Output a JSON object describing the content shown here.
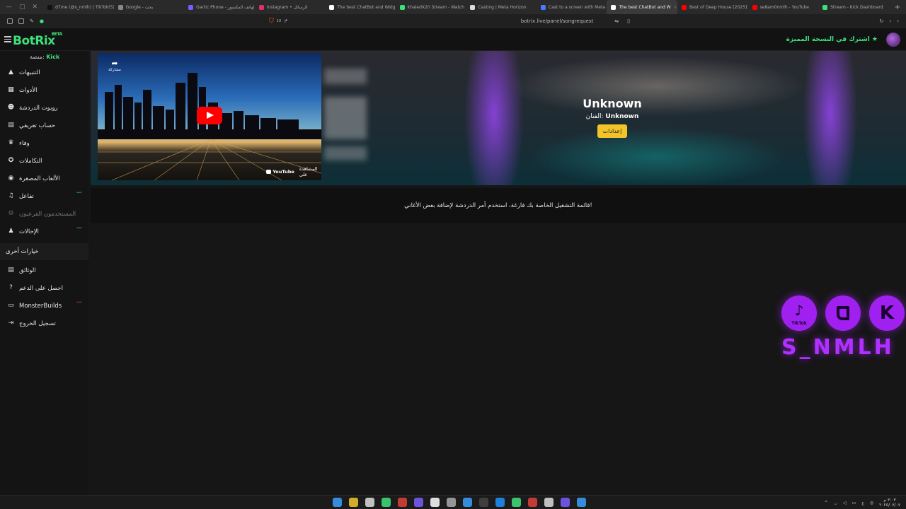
{
  "browser": {
    "tabs": [
      {
        "title": "d7me (@s_nmlh) | TikTok(5)",
        "color": "#111111"
      },
      {
        "title": "Google - بحث",
        "color": "#888888"
      },
      {
        "title": "Gartic Phone - الهاتف المكسور",
        "color": "#7a5cff"
      },
      {
        "title": "Instagram • الرسائل",
        "color": "#e1306c"
      },
      {
        "title": "The best ChatBot and Widg",
        "color": "#ffffff"
      },
      {
        "title": "khaledX20 Stream - Watch",
        "color": "#3ee07a"
      },
      {
        "title": "Casting | Meta Horizon",
        "color": "#dddddd"
      },
      {
        "title": "Cast to a screen with Meta",
        "color": "#4a7bff"
      },
      {
        "title": "The best ChatBot and W",
        "color": "#ffffff",
        "active": true
      },
      {
        "title": "Best of Deep House [2025]",
        "color": "#ff0000"
      },
      {
        "title": "se8am0nmlh - YouTube",
        "color": "#ff0000"
      },
      {
        "title": "Stream - Kick Dashboard",
        "color": "#3ee07a"
      }
    ],
    "url": "botrix.live/panel/songrequest",
    "shield_count": "10"
  },
  "header": {
    "logo": "BotRix",
    "beta": "BETA",
    "premium_text": "اشترك في النسخة المميزة"
  },
  "sidebar": {
    "platform_label": "منصة:",
    "platform_value": "Kick",
    "items": [
      {
        "label": "التنبيهات",
        "icon": "warning-icon",
        "glyph": "▲"
      },
      {
        "label": "الأدوات",
        "icon": "tools-icon",
        "glyph": "▦"
      },
      {
        "label": "روبوت الدردشة",
        "icon": "robot-icon",
        "glyph": "☻"
      },
      {
        "label": "حساب تعريفي",
        "icon": "id-card-icon",
        "glyph": "▤"
      },
      {
        "label": "وفاء",
        "icon": "trophy-icon",
        "glyph": "♛"
      },
      {
        "label": "التكاملات",
        "icon": "integrations-icon",
        "glyph": "✪"
      },
      {
        "label": "الألعاب المصغرة",
        "icon": "gamepad-icon",
        "glyph": "◉"
      },
      {
        "label": "تفاعل",
        "icon": "music-icon",
        "glyph": "♫",
        "tag": "جديد"
      },
      {
        "label": "المستخدمون الفرعيون",
        "icon": "gear-icon",
        "glyph": "⚙",
        "dim": true
      },
      {
        "label": "الإحالات",
        "icon": "users-icon",
        "glyph": "♟",
        "tag": "جديد"
      }
    ],
    "section_title": "خيارات أخرى",
    "other_items": [
      {
        "label": "الوثائق",
        "icon": "book-icon",
        "glyph": "▤"
      },
      {
        "label": "احصل على الدعم",
        "icon": "question-icon",
        "glyph": "?"
      },
      {
        "label": "MonsterBuilds",
        "icon": "laptop-icon",
        "glyph": "▭",
        "tag": "جديد",
        "tag_red": true
      },
      {
        "label": "تسجيل الخروج",
        "icon": "logout-icon",
        "glyph": "⇥"
      }
    ]
  },
  "player": {
    "share_label": "مشاركة",
    "watch_on": "المشاهدة على",
    "youtube": "YouTube",
    "song_title": "Unknown",
    "artist_label": "الفنان:",
    "artist_value": "Unknown",
    "settings_button": "إعدادات"
  },
  "playlist": {
    "empty_message": "قائمة التشغيل الخاصة بك فارغة، استخدم أمر الدردشة لإضافة بعض الأغاني!"
  },
  "overlay": {
    "tiktok_label": "TikTok",
    "username": "S_NMLH"
  },
  "taskbar": {
    "time": "٣:٠٣ م",
    "date": "٢٠٢٥/٠٧/٠٧",
    "lang": "ع",
    "apps": [
      "#3aa0ff",
      "#f2c42a",
      "#dddddd",
      "#3ee07a",
      "#e0413a",
      "#7a5cff",
      "#ffffff",
      "#aaaaaa",
      "#3aa0ff",
      "#444444",
      "#1e90ff",
      "#3ee07a",
      "#e0413a",
      "#dddddd",
      "#7a5cff",
      "#3aa0ff"
    ]
  }
}
